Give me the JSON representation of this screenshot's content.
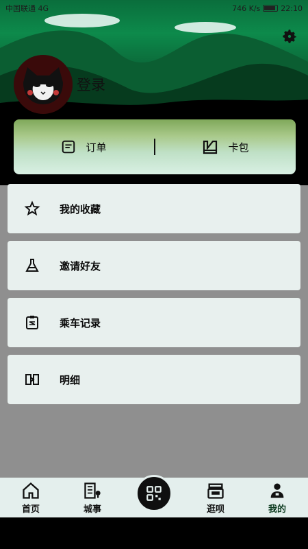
{
  "status_bar": {
    "left": "中国联通 4G",
    "right": "746 K/s",
    "time": "22:10"
  },
  "profile": {
    "login_label": "登录"
  },
  "quick_actions": [
    {
      "label": "订单",
      "icon": "order-icon"
    },
    {
      "label": "卡包",
      "icon": "card-wallet-icon"
    }
  ],
  "menu": [
    {
      "label": "我的收藏",
      "icon": "star-icon"
    },
    {
      "label": "邀请好友",
      "icon": "flask-icon"
    },
    {
      "label": "乘车记录",
      "icon": "clipboard-icon"
    },
    {
      "label": "明细",
      "icon": "ticket-icon"
    }
  ],
  "tabbar": {
    "items": [
      {
        "label": "首页",
        "icon": "home-icon"
      },
      {
        "label": "城事",
        "icon": "building-icon"
      },
      {
        "label": "",
        "icon": "qr-scan-icon"
      },
      {
        "label": "逛呗",
        "icon": "shop-icon"
      },
      {
        "label": "我的",
        "icon": "user-icon"
      }
    ],
    "active": "我的"
  },
  "colors": {
    "accent": "#0d8a4b",
    "card_bg": "#e8f0ee",
    "tabbar_bg": "#e4efed"
  }
}
